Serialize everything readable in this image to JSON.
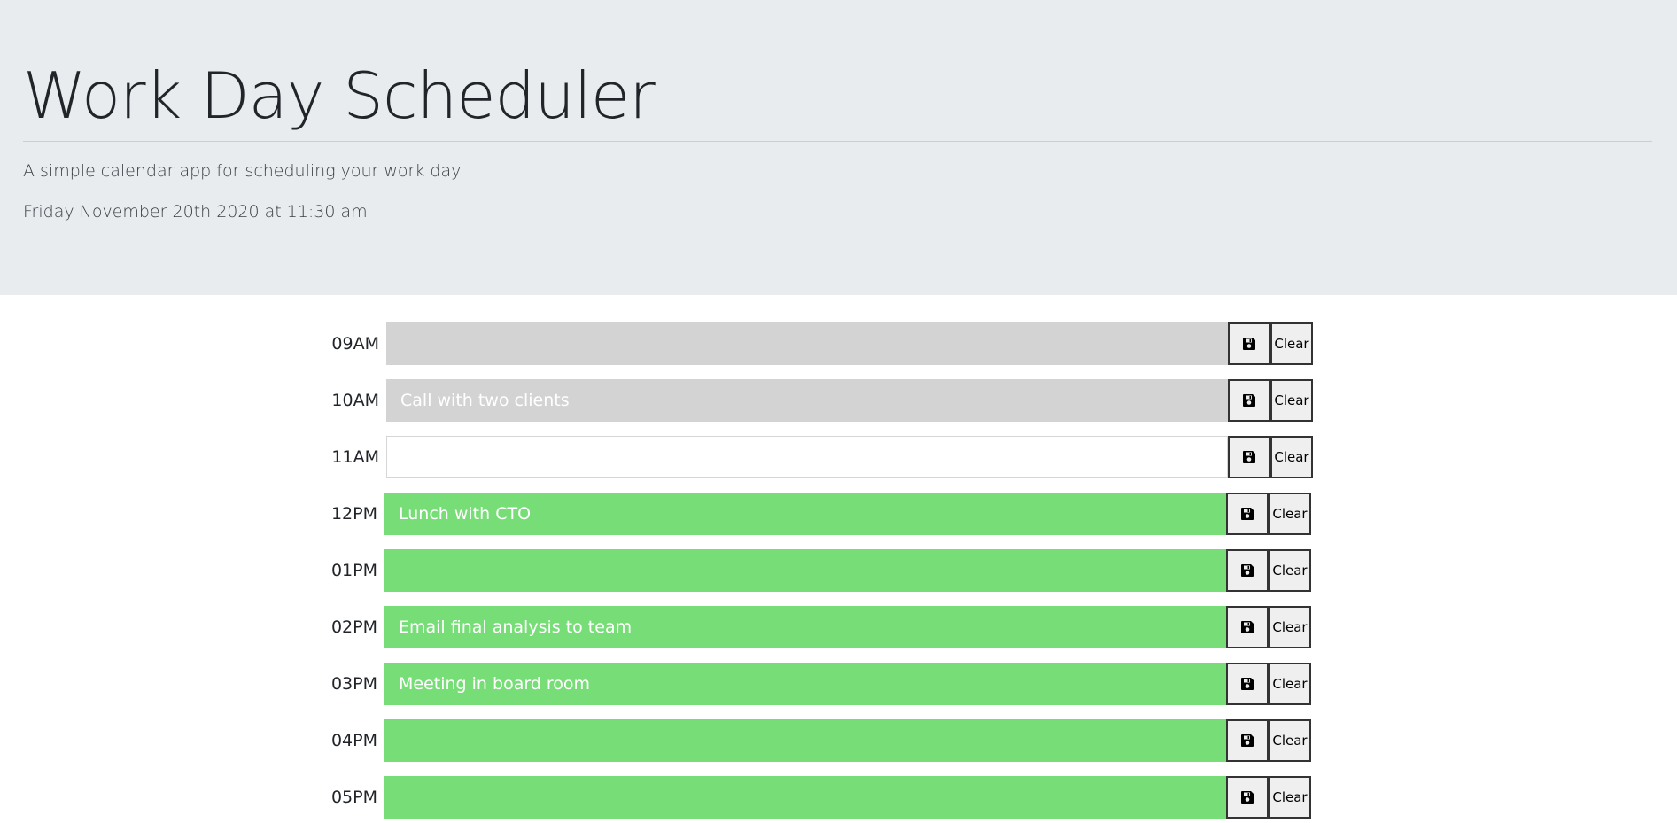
{
  "header": {
    "title": "Work Day Scheduler",
    "subtitle": "A simple calendar app for scheduling your work day",
    "current_day": "Friday November 20th 2020 at 11:30 am"
  },
  "colors": {
    "header_bg": "#e9ecef",
    "past": "#d3d3d3",
    "present": "#ffffff",
    "future": "#77dd77"
  },
  "schedule": {
    "save_icon": "save-icon",
    "clear_label": "Clear",
    "rows": [
      {
        "hour": "09AM",
        "text": "",
        "state": "past"
      },
      {
        "hour": "10AM",
        "text": "Call with two clients",
        "state": "past"
      },
      {
        "hour": "11AM",
        "text": "",
        "state": "present"
      },
      {
        "hour": "12PM",
        "text": "Lunch with CTO",
        "state": "future"
      },
      {
        "hour": "01PM",
        "text": "",
        "state": "future"
      },
      {
        "hour": "02PM",
        "text": "Email final analysis to team",
        "state": "future"
      },
      {
        "hour": "03PM",
        "text": "Meeting in board room",
        "state": "future"
      },
      {
        "hour": "04PM",
        "text": "",
        "state": "future"
      },
      {
        "hour": "05PM",
        "text": "",
        "state": "future"
      }
    ]
  }
}
